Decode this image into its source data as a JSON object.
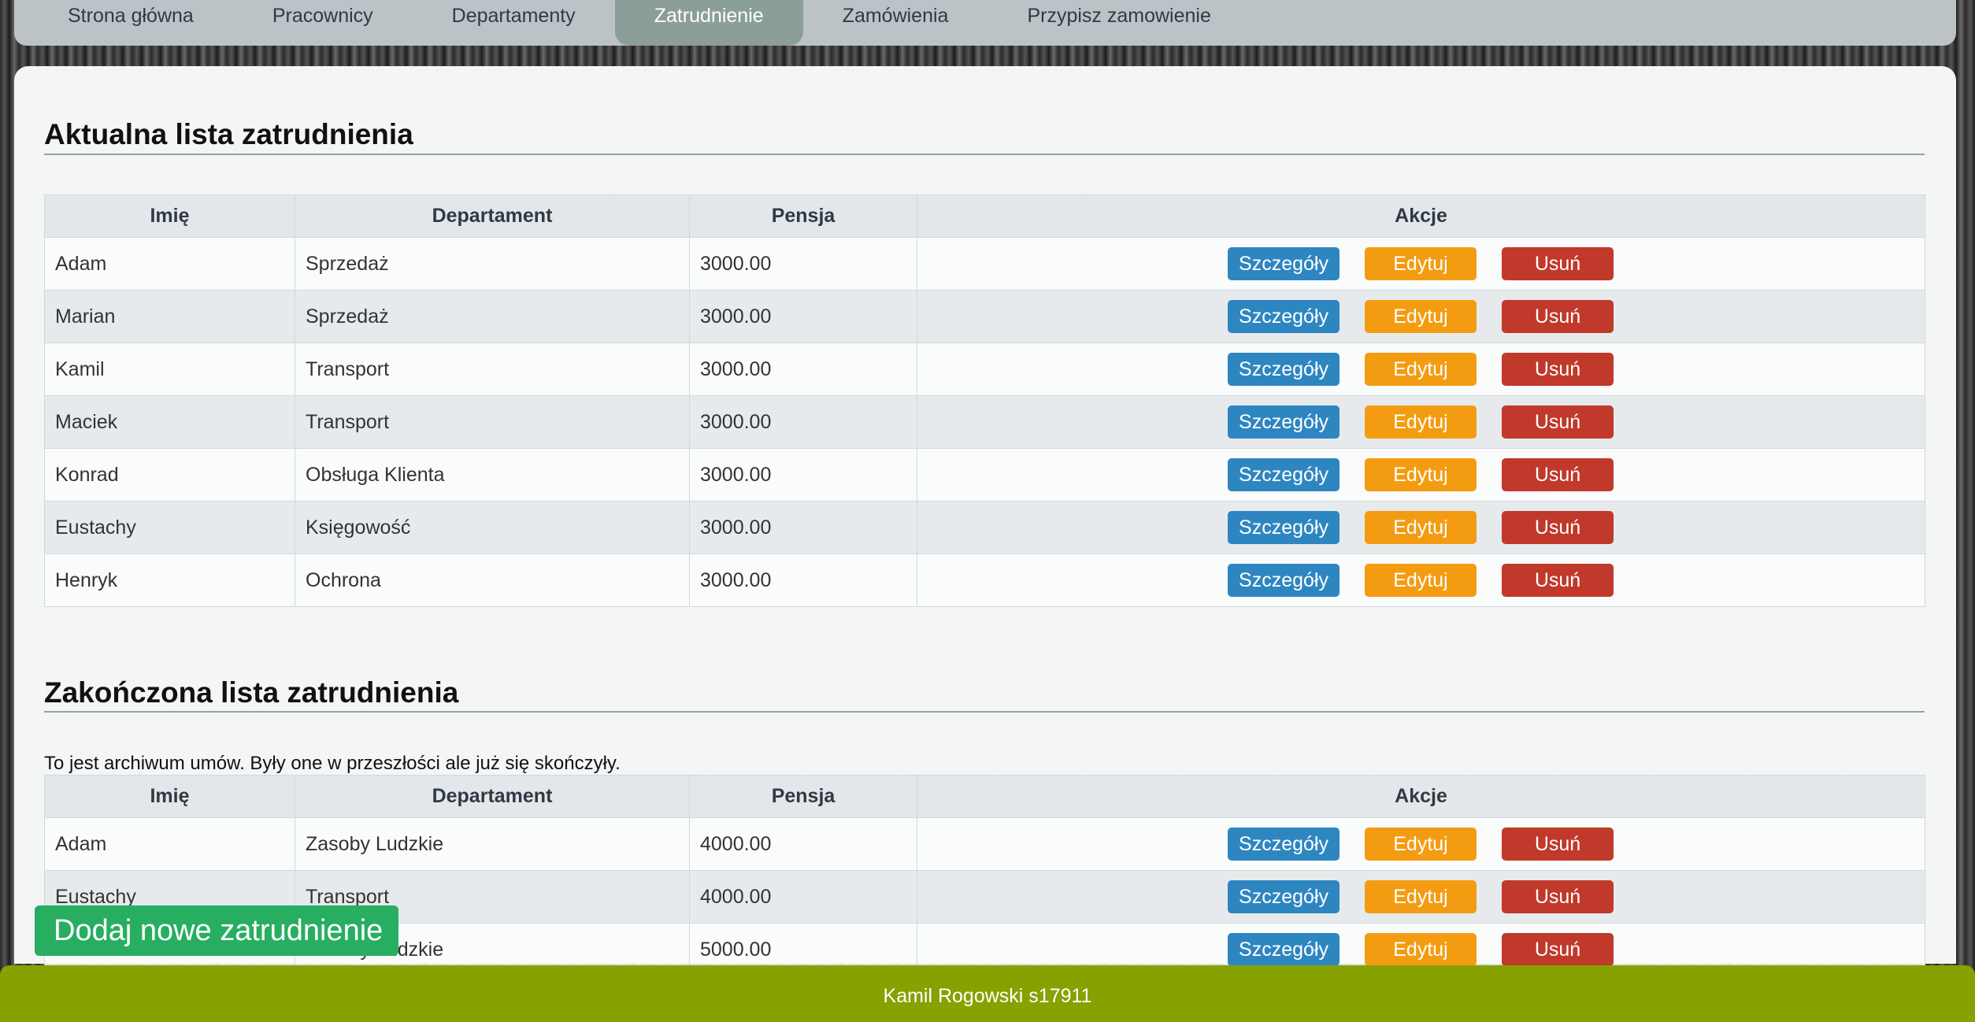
{
  "nav": {
    "items": [
      {
        "label": "Strona główna"
      },
      {
        "label": "Pracownicy"
      },
      {
        "label": "Departamenty"
      },
      {
        "label": "Zatrudnienie"
      },
      {
        "label": "Zamówienia"
      },
      {
        "label": "Przypisz zamowienie"
      }
    ],
    "active_index": 3
  },
  "current": {
    "title": "Aktualna lista zatrudnienia",
    "headers": [
      "Imię",
      "Departament",
      "Pensja",
      "Akcje"
    ],
    "rows": [
      {
        "name": "Adam",
        "department": "Sprzedaż",
        "salary": "3000.00"
      },
      {
        "name": "Marian",
        "department": "Sprzedaż",
        "salary": "3000.00"
      },
      {
        "name": "Kamil",
        "department": "Transport",
        "salary": "3000.00"
      },
      {
        "name": "Maciek",
        "department": "Transport",
        "salary": "3000.00"
      },
      {
        "name": "Konrad",
        "department": "Obsługa Klienta",
        "salary": "3000.00"
      },
      {
        "name": "Eustachy",
        "department": "Księgowość",
        "salary": "3000.00"
      },
      {
        "name": "Henryk",
        "department": "Ochrona",
        "salary": "3000.00"
      }
    ]
  },
  "ended": {
    "title": "Zakończona lista zatrudnienia",
    "note": "To jest archiwum umów. Były one w przeszłości ale już się skończyły.",
    "headers": [
      "Imię",
      "Departament",
      "Pensja",
      "Akcje"
    ],
    "rows": [
      {
        "name": "Adam",
        "department": "Zasoby Ludzkie",
        "salary": "4000.00"
      },
      {
        "name": "Eustachy",
        "department": "Transport",
        "salary": "4000.00"
      },
      {
        "name": "",
        "department": "Zasoby Ludzkie",
        "salary": "5000.00"
      }
    ]
  },
  "actions": {
    "details": "Szczegóły",
    "edit": "Edytuj",
    "delete": "Usuń"
  },
  "add_button": "Dodaj nowe zatrudnienie",
  "footer": "Kamil Rogowski s17911",
  "colors": {
    "details": "#2e86c1",
    "edit": "#f39c12",
    "delete": "#c0392b",
    "add": "#27ae60",
    "footer": "#85a200",
    "nav_active": "#8b9e9a"
  }
}
